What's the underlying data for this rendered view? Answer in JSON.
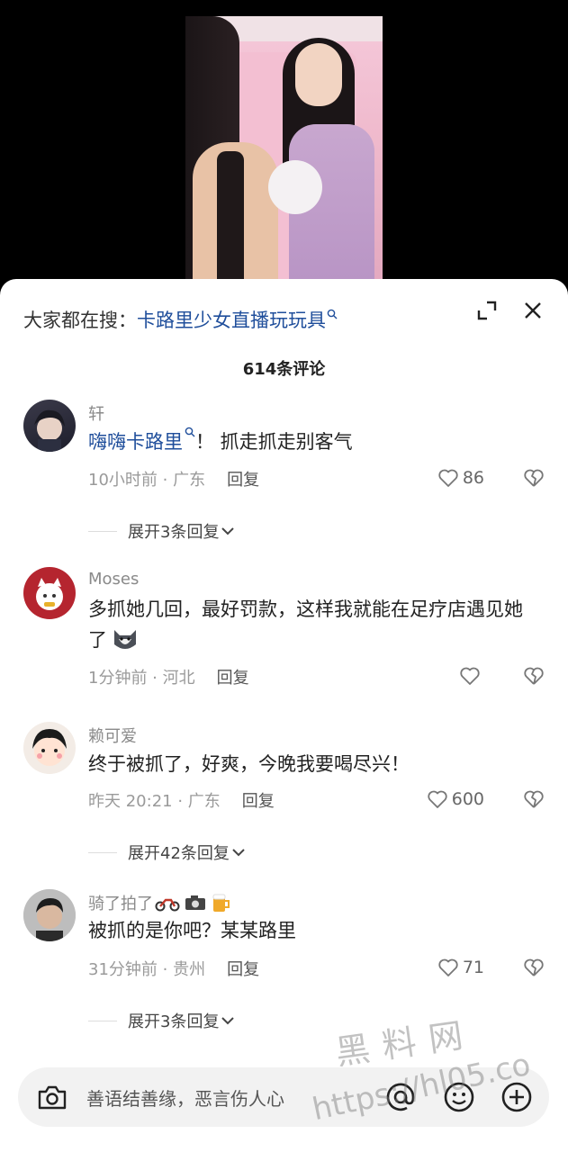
{
  "video": {
    "description_icon": "video-thumbnail"
  },
  "search": {
    "prefix": "大家都在搜：",
    "term": "卡路里少女直播玩玩具"
  },
  "comment_count": "614条评论",
  "comments": [
    {
      "user": "轩",
      "mention": "嗨嗨卡路里",
      "text": "！ 抓走抓走别客气",
      "time": "10小时前 · 广东",
      "reply": "回复",
      "likes": "86",
      "expand": "展开3条回复"
    },
    {
      "user": "Moses",
      "text": "多抓她几回，最好罚款，这样我就能在足疗店遇见她了",
      "time": "1分钟前 · 河北",
      "reply": "回复",
      "likes": ""
    },
    {
      "user": "赖可爱",
      "text": "终于被抓了，好爽，今晚我要喝尽兴！",
      "time": "昨天 20:21 · 广东",
      "reply": "回复",
      "likes": "600",
      "expand": "展开42条回复"
    },
    {
      "user": "骑了拍了",
      "text": "被抓的是你吧？某某路里",
      "time": "31分钟前 · 贵州",
      "reply": "回复",
      "likes": "71",
      "expand": "展开3条回复"
    }
  ],
  "input": {
    "placeholder": "善语结善缘，恶言伤人心"
  },
  "watermark": {
    "line1": "黑料网",
    "line2": "https://hl05.co"
  },
  "colors": {
    "link": "#1f4e9b",
    "muted": "#9a9a9a"
  }
}
